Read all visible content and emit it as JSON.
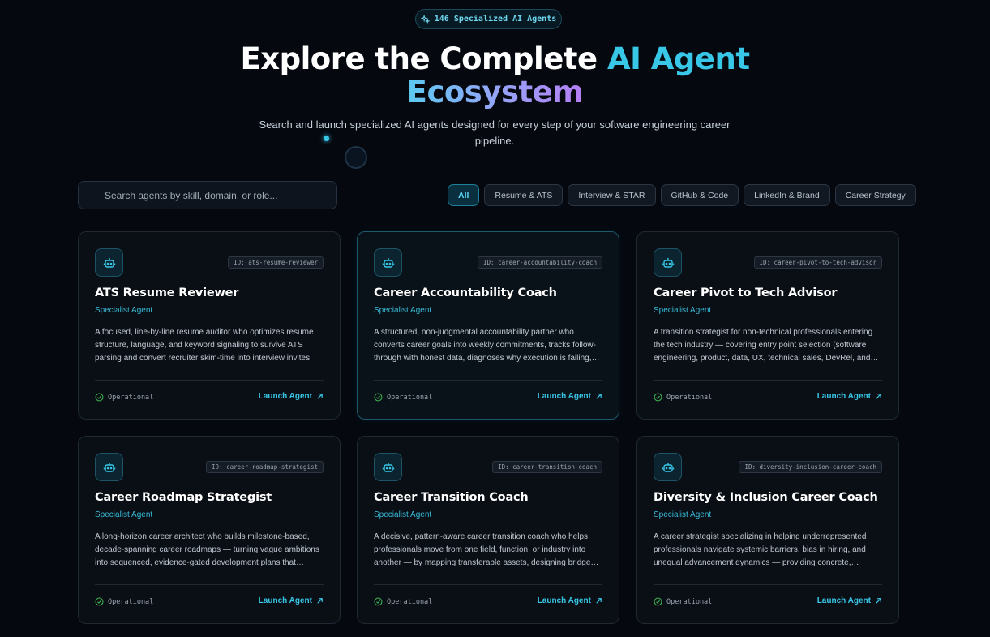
{
  "badge": {
    "icon": "sparkles-icon",
    "text": "146 Specialized AI Agents"
  },
  "hero": {
    "title_part1": "Explore the Complete ",
    "title_part2": "AI Agent",
    "title_part3": "Ecosystem",
    "subtitle": "Search and launch specialized AI agents designed for every step of your software engineering career pipeline."
  },
  "search": {
    "placeholder": "Search agents by skill, domain, or role...",
    "value": ""
  },
  "filters": [
    {
      "label": "All",
      "active": true
    },
    {
      "label": "Resume & ATS",
      "active": false
    },
    {
      "label": "Interview & STAR",
      "active": false
    },
    {
      "label": "GitHub & Code",
      "active": false
    },
    {
      "label": "LinkedIn & Brand",
      "active": false
    },
    {
      "label": "Career Strategy",
      "active": false
    }
  ],
  "cards": [
    {
      "id": "ID: ats-resume-reviewer",
      "title": "ATS Resume Reviewer",
      "role": "Specialist Agent",
      "description": "A focused, line-by-line resume auditor who optimizes resume structure, language, and keyword signaling to survive ATS parsing and convert recruiter skim-time into interview invites.",
      "status": "Operational",
      "action": "Launch Agent"
    },
    {
      "id": "ID: career-accountability-coach",
      "title": "Career Accountability Coach",
      "role": "Specialist Agent",
      "description": "A structured, non-judgmental accountability partner who converts career goals into weekly commitments, tracks follow-through with honest data, diagnoses why execution is failing,…",
      "status": "Operational",
      "action": "Launch Agent"
    },
    {
      "id": "ID: career-pivot-to-tech-advisor",
      "title": "Career Pivot to Tech Advisor",
      "role": "Specialist Agent",
      "description": "A transition strategist for non-technical professionals entering the tech industry — covering entry point selection (software engineering, product, data, UX, technical sales, DevRel, and…",
      "status": "Operational",
      "action": "Launch Agent"
    },
    {
      "id": "ID: career-roadmap-strategist",
      "title": "Career Roadmap Strategist",
      "role": "Specialist Agent",
      "description": "A long-horizon career architect who builds milestone-based, decade-spanning career roadmaps — turning vague ambitions into sequenced, evidence-gated development plans that…",
      "status": "Operational",
      "action": "Launch Agent"
    },
    {
      "id": "ID: career-transition-coach",
      "title": "Career Transition Coach",
      "role": "Specialist Agent",
      "description": "A decisive, pattern-aware career transition coach who helps professionals move from one field, function, or industry into another — by mapping transferable assets, designing bridge…",
      "status": "Operational",
      "action": "Launch Agent"
    },
    {
      "id": "ID: diversity-inclusion-career-coach",
      "title": "Diversity & Inclusion Career Coach",
      "role": "Specialist Agent",
      "description": "A career strategist specializing in helping underrepresented professionals navigate systemic barriers, bias in hiring, and unequal advancement dynamics — providing concrete,…",
      "status": "Operational",
      "action": "Launch Agent"
    }
  ],
  "colors": {
    "accent": "#38c7e6",
    "background": "#05080f",
    "success": "#3fb950"
  }
}
